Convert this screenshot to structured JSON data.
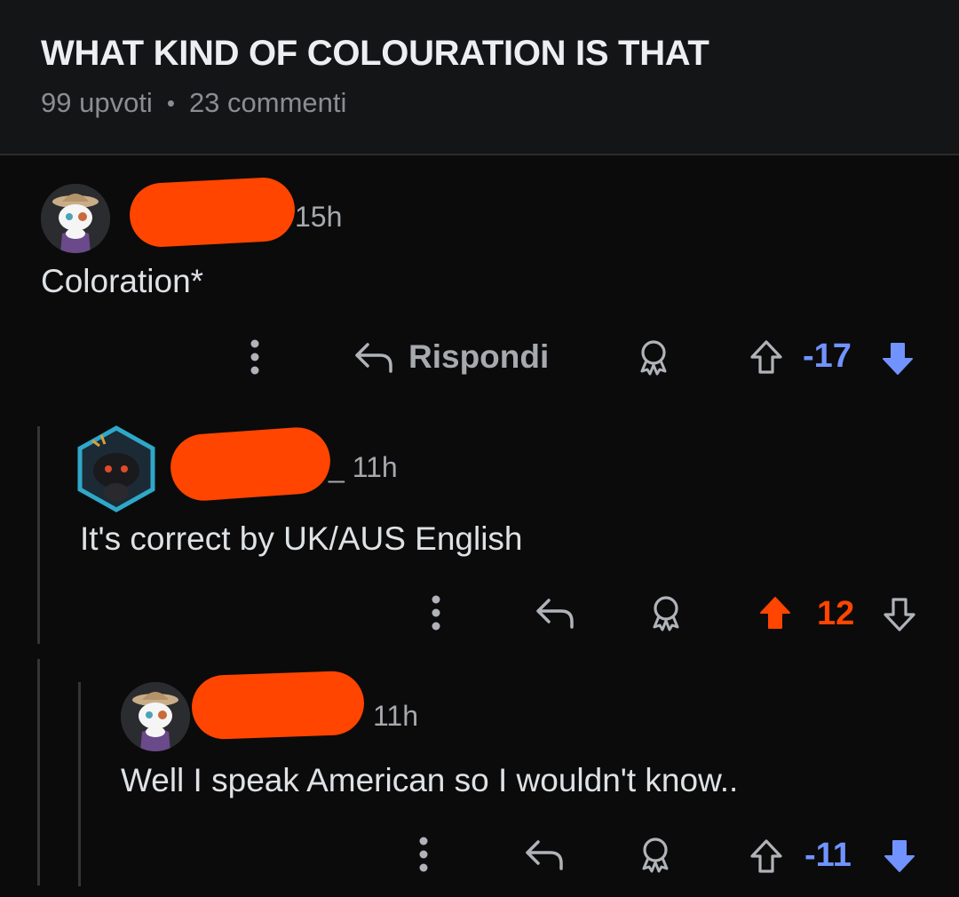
{
  "post": {
    "title": "WHAT KIND OF COLOURATION IS THAT",
    "upvotes": "99 upvoti",
    "separator": "•",
    "comments": "23 commenti"
  },
  "comments": [
    {
      "timestamp": "15h",
      "body": "Coloration*",
      "reply_label": "Rispondi",
      "score": "-17",
      "vote_state": "downvoted"
    },
    {
      "timestamp": "_ 11h",
      "body": "It's correct by UK/AUS English",
      "score": "12",
      "vote_state": "upvoted"
    },
    {
      "timestamp": "11h",
      "body": "Well I speak American so I wouldn't know..",
      "score": "-11",
      "vote_state": "downvoted"
    }
  ],
  "colors": {
    "accent_upvote": "#ff4500",
    "accent_downvote": "#7193ff",
    "background": "#0b0b0c",
    "header_background": "#141516"
  },
  "icons": [
    "more-options-icon",
    "reply-arrow-icon",
    "award-icon",
    "upvote-arrow-icon",
    "downvote-arrow-icon"
  ]
}
